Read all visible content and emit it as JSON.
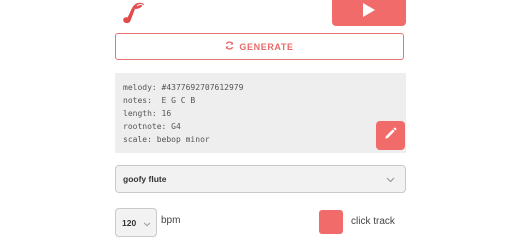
{
  "colors": {
    "accent": "#f26b6b",
    "panel_bg": "#eeeeee",
    "select_bg": "#f2f2f2"
  },
  "header": {
    "logo_icon": "music-note-logo",
    "play_icon": "play-icon"
  },
  "toolbar": {
    "generate_label": "GENERATE",
    "generate_icon": "refresh-icon"
  },
  "melody_info": {
    "melody": "melody: #4377692707612979",
    "notes": "notes:  E G C B",
    "length": "length: 16",
    "rootnote": "rootnote: G4",
    "scale": "scale: bebop minor",
    "edit_icon": "pencil-icon"
  },
  "instrument": {
    "selected": "goofy flute",
    "icon": "chevron-down-icon"
  },
  "tempo": {
    "bpm_value": "120",
    "bpm_label": "bpm"
  },
  "click_track": {
    "label": "click track",
    "enabled": true
  }
}
